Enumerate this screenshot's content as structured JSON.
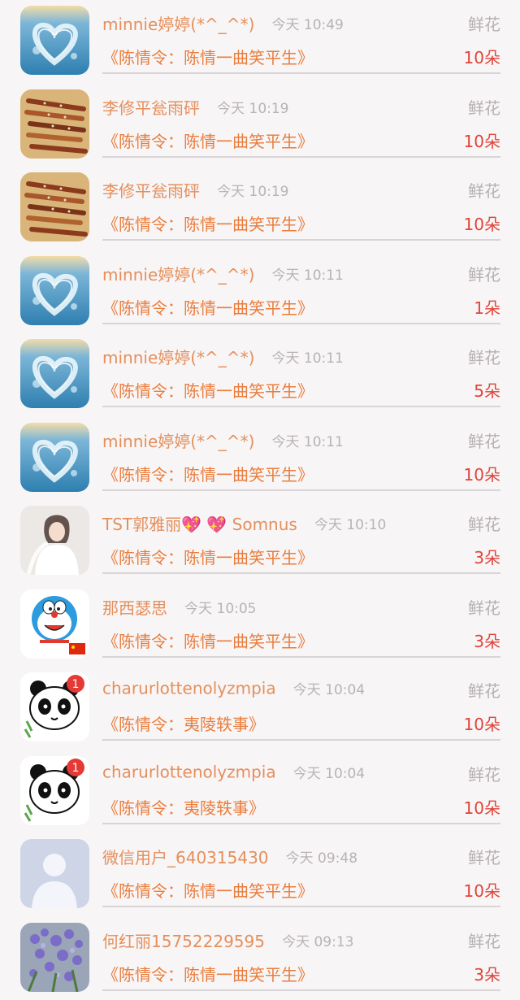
{
  "colors": {
    "background": "#f7f5f6",
    "name": "#e58f5b",
    "time": "#b9b3b3",
    "title": "#ea7d3c",
    "count": "#e0443a",
    "gift": "#b6b0b0"
  },
  "items": [
    {
      "name": "minnie婷婷(*^_^*)",
      "time": "今天 10:49",
      "gift": "鲜花",
      "title": "《陈情令：陈情一曲笑平生》",
      "count": "10朵",
      "avatar": "heart-water-avatar"
    },
    {
      "name": "李修平瓮雨砰",
      "time": "今天 10:19",
      "gift": "鲜花",
      "title": "《陈情令：陈情一曲笑平生》",
      "count": "10朵",
      "avatar": "flutes-avatar"
    },
    {
      "name": "李修平瓮雨砰",
      "time": "今天 10:19",
      "gift": "鲜花",
      "title": "《陈情令：陈情一曲笑平生》",
      "count": "10朵",
      "avatar": "flutes-avatar"
    },
    {
      "name": "minnie婷婷(*^_^*)",
      "time": "今天 10:11",
      "gift": "鲜花",
      "title": "《陈情令：陈情一曲笑平生》",
      "count": "1朵",
      "avatar": "heart-water-avatar"
    },
    {
      "name": "minnie婷婷(*^_^*)",
      "time": "今天 10:11",
      "gift": "鲜花",
      "title": "《陈情令：陈情一曲笑平生》",
      "count": "5朵",
      "avatar": "heart-water-avatar"
    },
    {
      "name": "minnie婷婷(*^_^*)",
      "time": "今天 10:11",
      "gift": "鲜花",
      "title": "《陈情令：陈情一曲笑平生》",
      "count": "10朵",
      "avatar": "heart-water-avatar"
    },
    {
      "name": "TST郭雅丽💖 💖 Somnus",
      "time": "今天 10:10",
      "gift": "鲜花",
      "title": "《陈情令：陈情一曲笑平生》",
      "count": "3朵",
      "avatar": "bride-avatar"
    },
    {
      "name": "那西瑟思",
      "time": "今天 10:05",
      "gift": "鲜花",
      "title": "《陈情令：陈情一曲笑平生》",
      "count": "3朵",
      "avatar": "doraemon-avatar"
    },
    {
      "name": "charurlottenolyzmpia",
      "time": "今天 10:04",
      "gift": "鲜花",
      "title": "《陈情令：夷陵轶事》",
      "count": "10朵",
      "avatar": "panda-avatar"
    },
    {
      "name": "charurlottenolyzmpia",
      "time": "今天 10:04",
      "gift": "鲜花",
      "title": "《陈情令：夷陵轶事》",
      "count": "10朵",
      "avatar": "panda-avatar"
    },
    {
      "name": "微信用户_640315430",
      "time": "今天 09:48",
      "gift": "鲜花",
      "title": "《陈情令：陈情一曲笑平生》",
      "count": "10朵",
      "avatar": "default-user-avatar"
    },
    {
      "name": "何红丽15752229595",
      "time": "今天 09:13",
      "gift": "鲜花",
      "title": "《陈情令：陈情一曲笑平生》",
      "count": "3朵",
      "avatar": "flowers-avatar"
    }
  ]
}
